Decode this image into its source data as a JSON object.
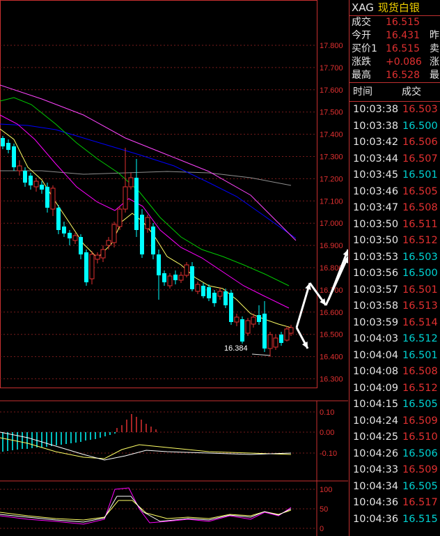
{
  "chart": {
    "price_axis": [
      "17.800",
      "17.700",
      "17.600",
      "17.500",
      "17.400",
      "17.300",
      "17.200",
      "17.100",
      "17.000",
      "16.900",
      "16.800",
      "16.700",
      "16.600",
      "16.500",
      "16.400",
      "16.300"
    ],
    "low_marker": "16.384",
    "macd_axis": [
      "0.10",
      "0.00",
      "-0.10"
    ],
    "kdj_axis": [
      "100",
      "50",
      "0"
    ],
    "colors": {
      "up": "#e03030",
      "down": "#00ffff",
      "ma5": "#ffff66",
      "ma10": "#ff00ff",
      "ma20": "#00cc00",
      "ma60": "#0000ff",
      "ma120": "#909090",
      "trend": "#ff44ff"
    }
  },
  "quote": {
    "symbol": "XAG",
    "name": "现货白银",
    "rows": [
      {
        "label": "成交",
        "value": "16.515",
        "label2": ""
      },
      {
        "label": "今开",
        "value": "16.431",
        "label2": "昨"
      },
      {
        "label": "买价1",
        "value": "16.515",
        "label2": "卖"
      },
      {
        "label": "涨跌",
        "value": "+0.086",
        "label2": "涨"
      },
      {
        "label": "最高",
        "value": "16.528",
        "label2": "最"
      }
    ]
  },
  "ticks": {
    "col_time": "时间",
    "col_price": "成交",
    "rows": [
      {
        "time": "10:03:38",
        "price": "16.503"
      },
      {
        "time": "10:03:38",
        "price": "16.500"
      },
      {
        "time": "10:03:42",
        "price": "16.506"
      },
      {
        "time": "10:03:44",
        "price": "16.507"
      },
      {
        "time": "10:03:45",
        "price": "16.501"
      },
      {
        "time": "10:03:46",
        "price": "16.505"
      },
      {
        "time": "10:03:47",
        "price": "16.508"
      },
      {
        "time": "10:03:50",
        "price": "16.511"
      },
      {
        "time": "10:03:50",
        "price": "16.512"
      },
      {
        "time": "10:03:53",
        "price": "16.503"
      },
      {
        "time": "10:03:56",
        "price": "16.500"
      },
      {
        "time": "10:03:57",
        "price": "16.501"
      },
      {
        "time": "10:03:58",
        "price": "16.513"
      },
      {
        "time": "10:03:59",
        "price": "16.514"
      },
      {
        "time": "10:04:03",
        "price": "16.512"
      },
      {
        "time": "10:04:04",
        "price": "16.501"
      },
      {
        "time": "10:04:08",
        "price": "16.508"
      },
      {
        "time": "10:04:09",
        "price": "16.512"
      },
      {
        "time": "10:04:15",
        "price": "16.505"
      },
      {
        "time": "10:04:24",
        "price": "16.509"
      },
      {
        "time": "10:04:25",
        "price": "16.510"
      },
      {
        "time": "10:04:26",
        "price": "16.506"
      },
      {
        "time": "10:04:33",
        "price": "16.509"
      },
      {
        "time": "10:04:34",
        "price": "16.505"
      },
      {
        "time": "10:04:36",
        "price": "16.517"
      },
      {
        "time": "10:04:36",
        "price": "16.515"
      }
    ]
  }
}
